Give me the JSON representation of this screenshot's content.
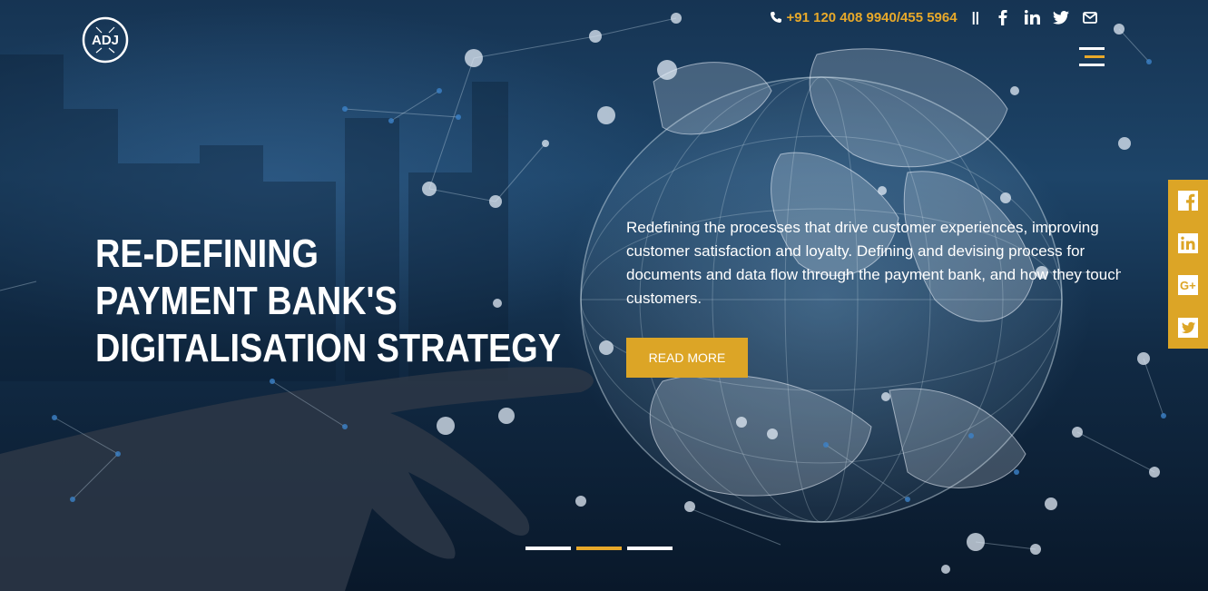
{
  "brand": {
    "logo_text": "ADJ"
  },
  "header": {
    "phone": "+91 120 408 9940/455 5964",
    "separator": "||",
    "social": [
      "facebook-icon",
      "linkedin-icon",
      "twitter-icon",
      "mail-icon"
    ],
    "menu_icon": "hamburger-menu-icon"
  },
  "hero": {
    "headline_lines": [
      "RE-DEFINING",
      "PAYMENT BANK'S",
      "DIGITALISATION STRATEGY"
    ],
    "description": "Redefining the processes that drive customer experiences, improving customer satisfaction and loyalty. Defining and devising process for documents and data flow through the payment bank, and how they touch customers.",
    "button_label": "READ MORE"
  },
  "side_social": [
    "facebook-icon",
    "linkedin-icon",
    "google-plus-icon",
    "twitter-icon"
  ],
  "slider": {
    "count": 3,
    "active_index": 1
  },
  "colors": {
    "accent": "#dca526",
    "text": "#ffffff"
  }
}
